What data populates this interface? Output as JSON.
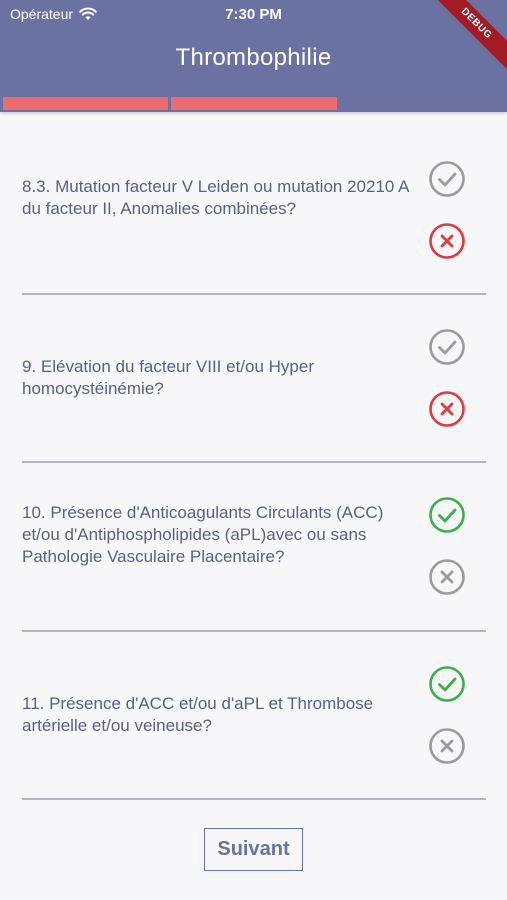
{
  "status_bar": {
    "carrier": "Opérateur",
    "time": "7:30 PM"
  },
  "appbar": {
    "title": "Thrombophilie",
    "debug_label": "DEBUG"
  },
  "progress": {
    "filled_segments": 2,
    "total_segments": 3,
    "fill_color": "#eb6b70"
  },
  "colors": {
    "primary": "#6b71a0",
    "yes_active": "#3fae49",
    "no_active": "#e0393e",
    "inactive": "#9b9b9b"
  },
  "questions": [
    {
      "text": "8.3. Mutation facteur V Leiden ou mutation 20210 A du facteur II, Anomalies combinées?",
      "yes_selected": false,
      "no_selected": true
    },
    {
      "text": "9. Elévation du facteur VIII et/ou Hyper homocystéinémie?",
      "yes_selected": false,
      "no_selected": true
    },
    {
      "text": "10. Présence d'Anticoagulants Circulants (ACC) et/ou d'Antiphospholipides (aPL)avec ou sans Pathologie Vasculaire Placentaire?",
      "yes_selected": true,
      "no_selected": false
    },
    {
      "text": "11. Présence d'ACC et/ou d'aPL et Thrombose artérielle et/ou veineuse?",
      "yes_selected": true,
      "no_selected": false
    }
  ],
  "footer": {
    "next_label": "Suivant"
  }
}
